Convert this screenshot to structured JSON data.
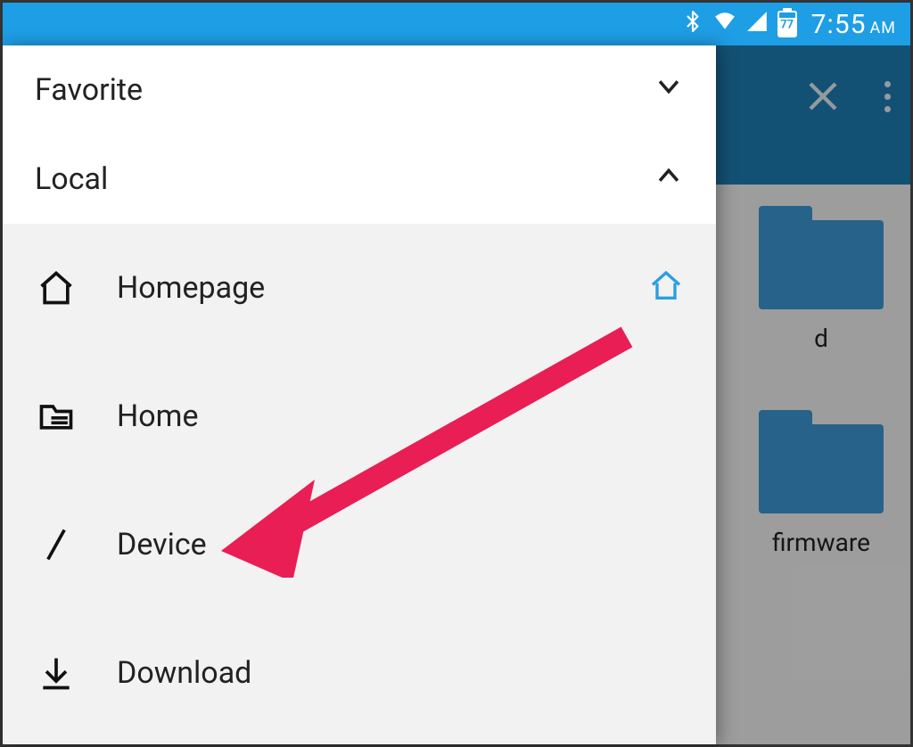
{
  "statusbar": {
    "battery_percent": "77",
    "time": "7:55",
    "ampm": "AM"
  },
  "background": {
    "folders": [
      {
        "label": "d"
      },
      {
        "label": "firmware"
      }
    ]
  },
  "drawer": {
    "sections": {
      "favorite": {
        "title": "Favorite",
        "expanded": false
      },
      "local": {
        "title": "Local",
        "expanded": true
      }
    },
    "local_items": [
      {
        "label": "Homepage"
      },
      {
        "label": "Home"
      },
      {
        "label": "Device"
      },
      {
        "label": "Download"
      }
    ]
  },
  "annotation": {
    "target": "Device"
  }
}
